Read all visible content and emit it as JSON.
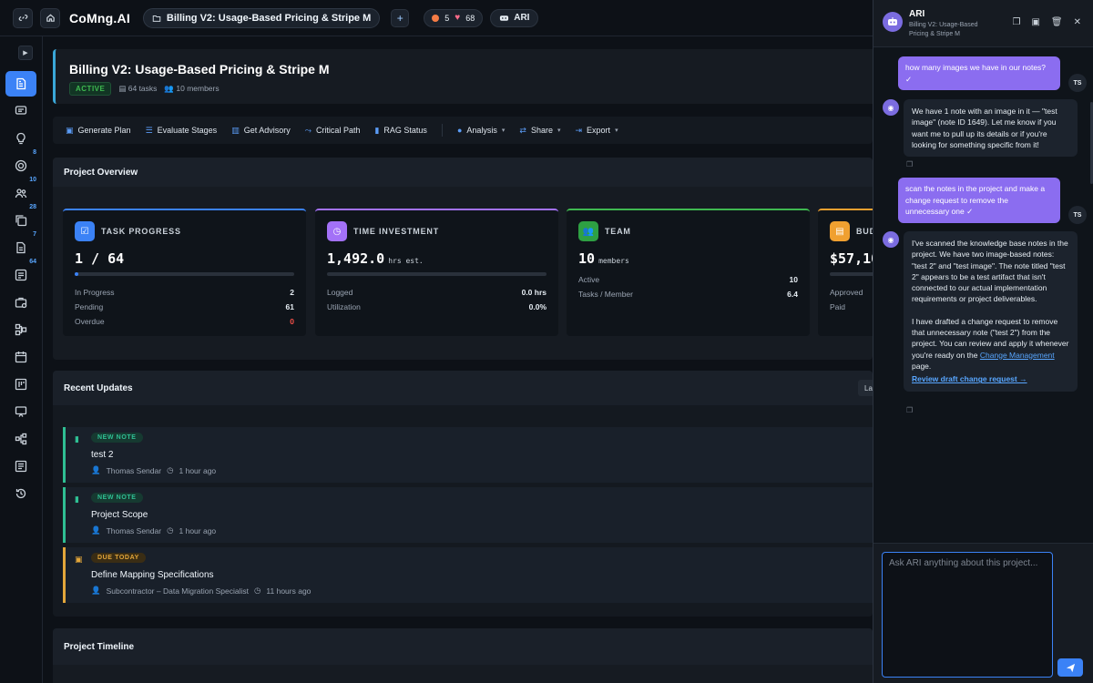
{
  "topbar": {
    "logo": "CoMng.AI",
    "project_title": "Billing V2: Usage-Based Pricing & Stripe M",
    "streak_count": "5",
    "hearts_count": "68",
    "ari_label": "ARI"
  },
  "sidebar": {
    "badges": {
      "targets": "8",
      "team": "10",
      "docs": "28",
      "files": "7",
      "tasks": "64"
    }
  },
  "project": {
    "title": "Billing V2: Usage-Based Pricing & Stripe M",
    "status": "ACTIVE",
    "tasks": "64 tasks",
    "members": "10 members"
  },
  "toolbar": {
    "generate_plan": "Generate Plan",
    "evaluate_stages": "Evaluate Stages",
    "get_advisory": "Get Advisory",
    "critical_path": "Critical Path",
    "rag_status": "RAG Status",
    "analysis": "Analysis",
    "share": "Share",
    "export": "Export"
  },
  "overview": {
    "heading": "Project Overview",
    "task_progress": {
      "title": "TASK PROGRESS",
      "value": "1 / 64",
      "progress": 0.016,
      "rows": [
        {
          "label": "In Progress",
          "value": "2"
        },
        {
          "label": "Pending",
          "value": "61"
        },
        {
          "label": "Overdue",
          "value": "0"
        }
      ]
    },
    "time_investment": {
      "title": "TIME INVESTMENT",
      "value": "1,492.0",
      "unit": "hrs est.",
      "rows": [
        {
          "label": "Logged",
          "value": "0.0 hrs"
        },
        {
          "label": "Utilization",
          "value": "0.0%"
        }
      ]
    },
    "team": {
      "title": "TEAM",
      "value": "10",
      "unit": "members",
      "rows": [
        {
          "label": "Active",
          "value": "10"
        },
        {
          "label": "Tasks / Member",
          "value": "6.4"
        }
      ]
    },
    "budget": {
      "title": "BUD",
      "value": "$57,10",
      "rows": [
        {
          "label": "Approved",
          "value": ""
        },
        {
          "label": "Paid",
          "value": ""
        }
      ]
    }
  },
  "updates": {
    "heading": "Recent Updates",
    "filter_label": "La",
    "items": [
      {
        "tag": "NEW NOTE",
        "title": "test 2",
        "author": "Thomas Sendar",
        "time": "1 hour ago"
      },
      {
        "tag": "NEW NOTE",
        "title": "Project Scope",
        "author": "Thomas Sendar",
        "time": "1 hour ago"
      },
      {
        "tag": "DUE TODAY",
        "title": "Define Mapping Specifications",
        "author": "Subcontractor – Data Migration Specialist",
        "time": "11 hours ago"
      }
    ]
  },
  "timeline": {
    "heading": "Project Timeline"
  },
  "chat": {
    "name": "ARI",
    "subtitle": "Billing V2: Usage-Based Pricing & Stripe M",
    "user_initials": "TS",
    "messages": {
      "u1": "how many images we have in our notes?",
      "b1": "We have 1 note with an image in it — \"test image\" (note ID 1649). Let me know if you want me to pull up its details or if you're looking for something specific from it!",
      "u2": "scan the notes in the project and make a change request to remove the unnecessary one",
      "b2_p1": "I've scanned the knowledge base notes in the project. We have two image-based notes: \"test 2\" and \"test image\". The note titled \"test 2\" appears to be a test artifact that isn't connected to our actual implementation requirements or project deliverables.",
      "b2_p2_pre": "I have drafted a change request to remove that unnecessary note (\"test 2\") from the project. You can review and apply it whenever you're ready on the",
      "b2_link": "Change Management",
      "b2_p2_post": "page.",
      "b2_review": "Review draft change request →"
    },
    "input_placeholder": "Ask ARI anything about this project..."
  }
}
